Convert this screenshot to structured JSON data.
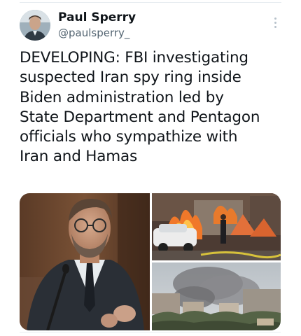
{
  "author": {
    "display_name": "Paul Sperry",
    "handle": "@paulsperry_"
  },
  "tweet": {
    "text": "DEVELOPING: FBI investigating\nsuspected Iran spy ring inside\nBiden administration led by\nState Department and Pentagon\nofficials who sympathize with\nIran and Hamas"
  },
  "media": {
    "images": [
      {
        "icon": "man-speaking-photo"
      },
      {
        "icon": "burning-cars-photo"
      },
      {
        "icon": "smoke-over-city-photo"
      }
    ]
  },
  "colors": {
    "text": "#0f1419",
    "secondary_text": "#536471",
    "divider": "#e6ecf0"
  }
}
